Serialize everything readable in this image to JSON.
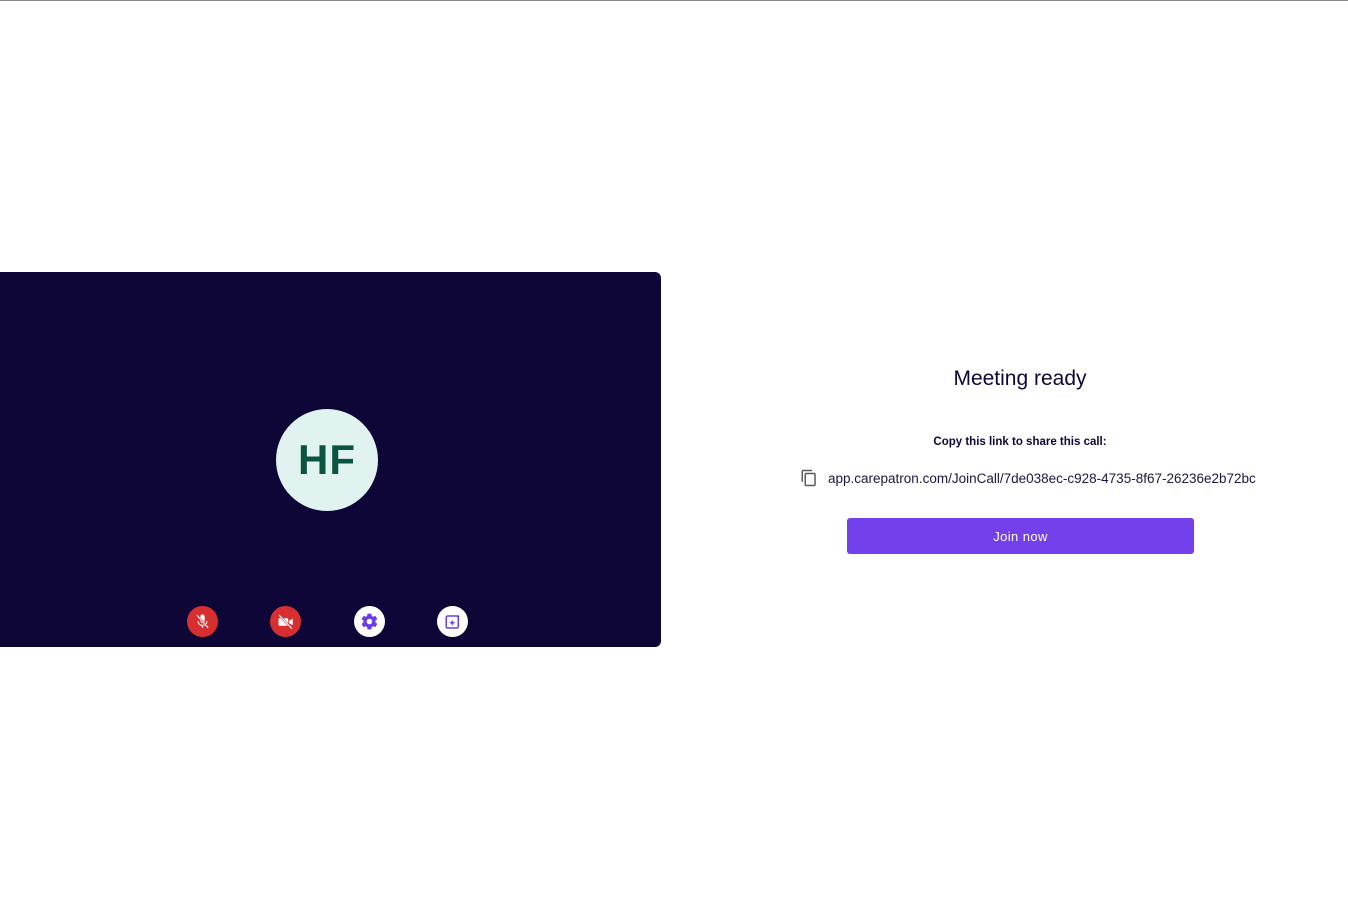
{
  "preview": {
    "avatar_initials": "HF",
    "controls": [
      {
        "name": "microphone-off",
        "icon": "mic-off-icon",
        "state": "muted",
        "color": "#d72f2f"
      },
      {
        "name": "camera-off",
        "icon": "video-off-icon",
        "state": "off",
        "color": "#d72f2f"
      },
      {
        "name": "settings",
        "icon": "gear-icon",
        "color": "#ffffff"
      },
      {
        "name": "effects",
        "icon": "background-effects-icon",
        "color": "#ffffff"
      }
    ],
    "background_color": "#0e0637"
  },
  "meeting": {
    "title": "Meeting ready",
    "copy_label": "Copy this link to share this call:",
    "link": "app.carepatron.com/JoinCall/7de038ec-c928-4735-8f67-26236e2b72bc",
    "copy_icon": "copy-icon",
    "join_label": "Join now",
    "accent_color": "#7440ec"
  }
}
